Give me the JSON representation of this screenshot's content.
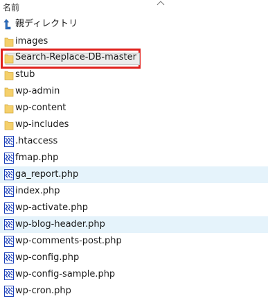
{
  "header": {
    "name_label": "名前"
  },
  "parent": {
    "label": "親ディレクトリ"
  },
  "rows": [
    {
      "label": "images",
      "kind": "folder",
      "highlighted": false
    },
    {
      "label": "Search-Replace-DB-master",
      "kind": "folder",
      "highlighted": false,
      "selected": true
    },
    {
      "label": "stub",
      "kind": "folder",
      "highlighted": false
    },
    {
      "label": "wp-admin",
      "kind": "folder",
      "highlighted": false
    },
    {
      "label": "wp-content",
      "kind": "folder",
      "highlighted": false
    },
    {
      "label": "wp-includes",
      "kind": "folder",
      "highlighted": false
    },
    {
      "label": ".htaccess",
      "kind": "file",
      "highlighted": false
    },
    {
      "label": "fmap.php",
      "kind": "file",
      "highlighted": false
    },
    {
      "label": "ga_report.php",
      "kind": "file",
      "highlighted": true
    },
    {
      "label": "index.php",
      "kind": "file",
      "highlighted": false
    },
    {
      "label": "wp-activate.php",
      "kind": "file",
      "highlighted": false
    },
    {
      "label": "wp-blog-header.php",
      "kind": "file",
      "highlighted": true
    },
    {
      "label": "wp-comments-post.php",
      "kind": "file",
      "highlighted": false
    },
    {
      "label": "wp-config.php",
      "kind": "file",
      "highlighted": false
    },
    {
      "label": "wp-config-sample.php",
      "kind": "file",
      "highlighted": false
    },
    {
      "label": "wp-cron.php",
      "kind": "file",
      "highlighted": false
    }
  ],
  "colors": {
    "row_highlight": "#e5f3fb",
    "selection_outline": "#e0201c",
    "folder_yellow": "#f5d06b",
    "file_icon_blue": "#1a3fb8"
  },
  "icons": {
    "parent": "up-arrow-icon",
    "folder": "folder-icon",
    "file": "php-file-icon",
    "sort": "sort-chevron-icon"
  }
}
